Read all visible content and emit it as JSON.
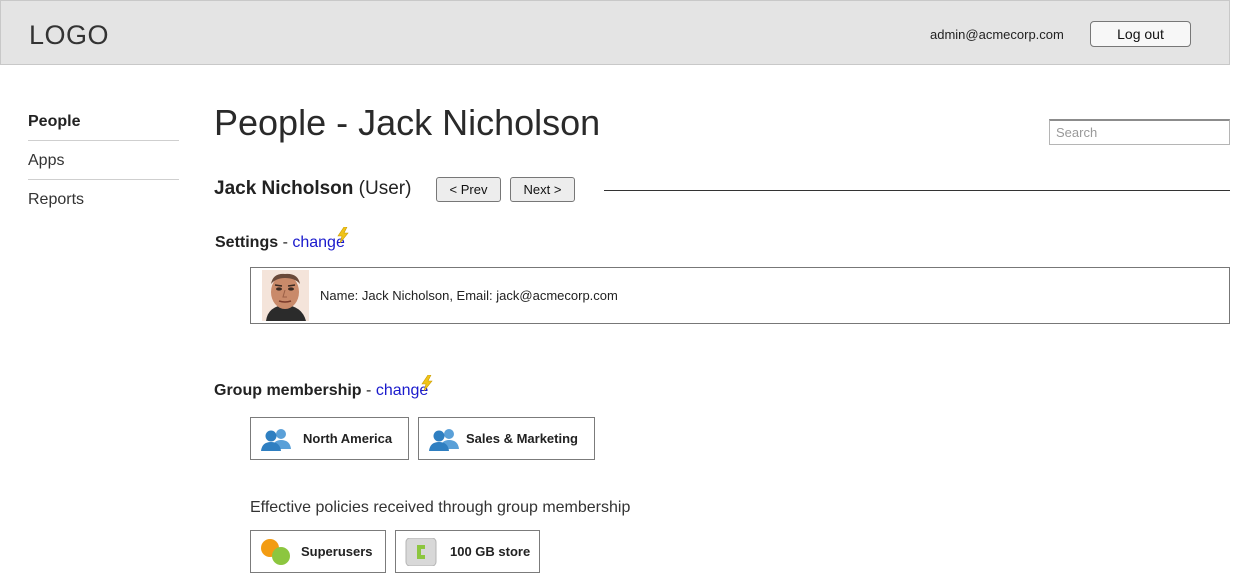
{
  "header": {
    "logo": "LOGO",
    "admin_email": "admin@acmecorp.com",
    "logout_label": "Log out"
  },
  "sidebar": {
    "items": [
      {
        "label": "People",
        "active": true
      },
      {
        "label": "Apps",
        "active": false
      },
      {
        "label": "Reports",
        "active": false
      }
    ]
  },
  "main": {
    "title": "People - Jack Nicholson",
    "search_placeholder": "Search",
    "user_name": "Jack Nicholson",
    "user_role": "(User)",
    "prev_label": "< Prev",
    "next_label": "Next >",
    "settings": {
      "heading": "Settings",
      "separator": "-",
      "change_label": "change",
      "details": "Name: Jack Nicholson, Email: jack@acmecorp.com"
    },
    "groups": {
      "heading": "Group membership",
      "separator": "-",
      "change_label": "change",
      "items": [
        {
          "label": "North America",
          "icon": "group-icon"
        },
        {
          "label": "Sales & Marketing",
          "icon": "group-icon"
        }
      ]
    },
    "policies": {
      "caption": "Effective policies received through group membership",
      "items": [
        {
          "label": "Superusers",
          "icon": "join-me-icon"
        },
        {
          "label": "100 GB store",
          "icon": "storage-icon"
        }
      ]
    }
  },
  "colors": {
    "header_bg": "#e4e4e4",
    "link": "#1a1acc",
    "group_icon": "#2f7fc1",
    "bolt": "#f0c419",
    "join_me_orange": "#f39c12",
    "join_me_green": "#8cc63f"
  }
}
